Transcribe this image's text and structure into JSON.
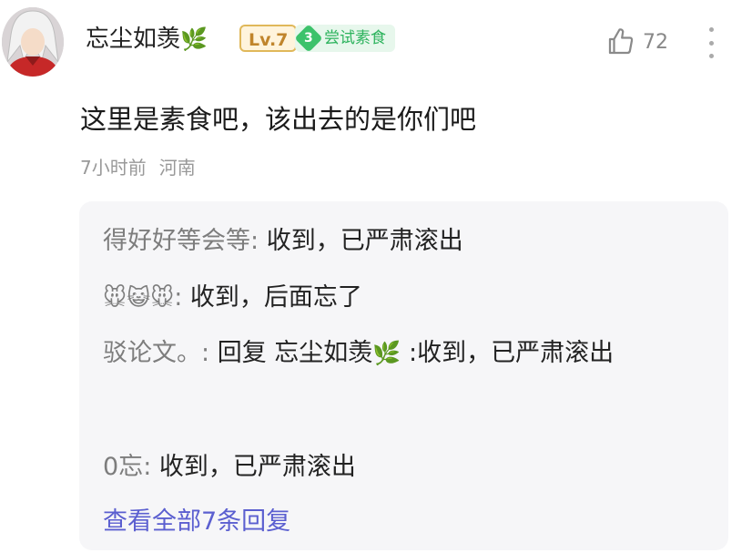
{
  "comment": {
    "username": "忘尘如羡",
    "username_leaf": "🌿",
    "level_badge": "Lv.7",
    "tag_level": "3",
    "tag_label": "尝试素食",
    "like_count": "72",
    "text": "这里是素食吧，该出去的是你们吧",
    "time": "7小时前",
    "location": "河南"
  },
  "replies": [
    {
      "author": "得好好等会等",
      "colon": ":",
      "text": " 收到，已严肃滚出"
    },
    {
      "author": "🐭😺🐭",
      "colon": ":",
      "text": " 收到，后面忘了"
    },
    {
      "author": "驳论文。",
      "colon": ":",
      "reply_prefix": " 回复 ",
      "reply_to": "忘尘如羡",
      "reply_to_leaf": "🌿",
      "text": " :收到，已严肃滚出"
    },
    {
      "author": "0忘",
      "colon": ":",
      "text": " 收到，已严肃滚出"
    }
  ],
  "view_all_label": "查看全部7条回复",
  "icons": {
    "like": "thumbs-up-icon",
    "more": "more-vertical-icon"
  },
  "colors": {
    "link": "#5b5fd0",
    "tag_green": "#2db35d",
    "level_gold": "#c0852c"
  }
}
